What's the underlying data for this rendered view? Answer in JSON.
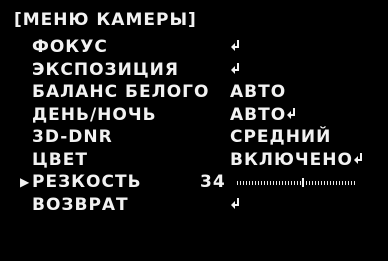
{
  "menu": {
    "title": "[МЕНЮ КАМЕРЫ]",
    "items": [
      {
        "label": "ФОКУС",
        "value": "",
        "enter": true,
        "selected": false
      },
      {
        "label": "ЭКСПОЗИЦИЯ",
        "value": "",
        "enter": true,
        "selected": false
      },
      {
        "label": "БАЛАНС БЕЛОГО",
        "value": "АВТО",
        "enter": false,
        "selected": false
      },
      {
        "label": "ДЕНЬ/НОЧЬ",
        "value": "АВТО",
        "enter": true,
        "selected": false
      },
      {
        "label": "3D-DNR",
        "value": "СРЕДНИЙ",
        "enter": false,
        "selected": false
      },
      {
        "label": "ЦВЕТ",
        "value": "ВКЛЮЧЕНО",
        "enter": true,
        "selected": false
      },
      {
        "label": "РЕЗКОСТЬ",
        "value": "34",
        "enter": false,
        "selected": true,
        "slider_fraction": 0.55
      },
      {
        "label": "ВОЗВРАТ",
        "value": "",
        "enter": true,
        "selected": false
      }
    ]
  },
  "colors": {
    "background": "#000000",
    "text": "#f2f2f2"
  },
  "icons": {
    "cursor": "triangle-right-icon",
    "enter": "enter-arrow-icon"
  }
}
